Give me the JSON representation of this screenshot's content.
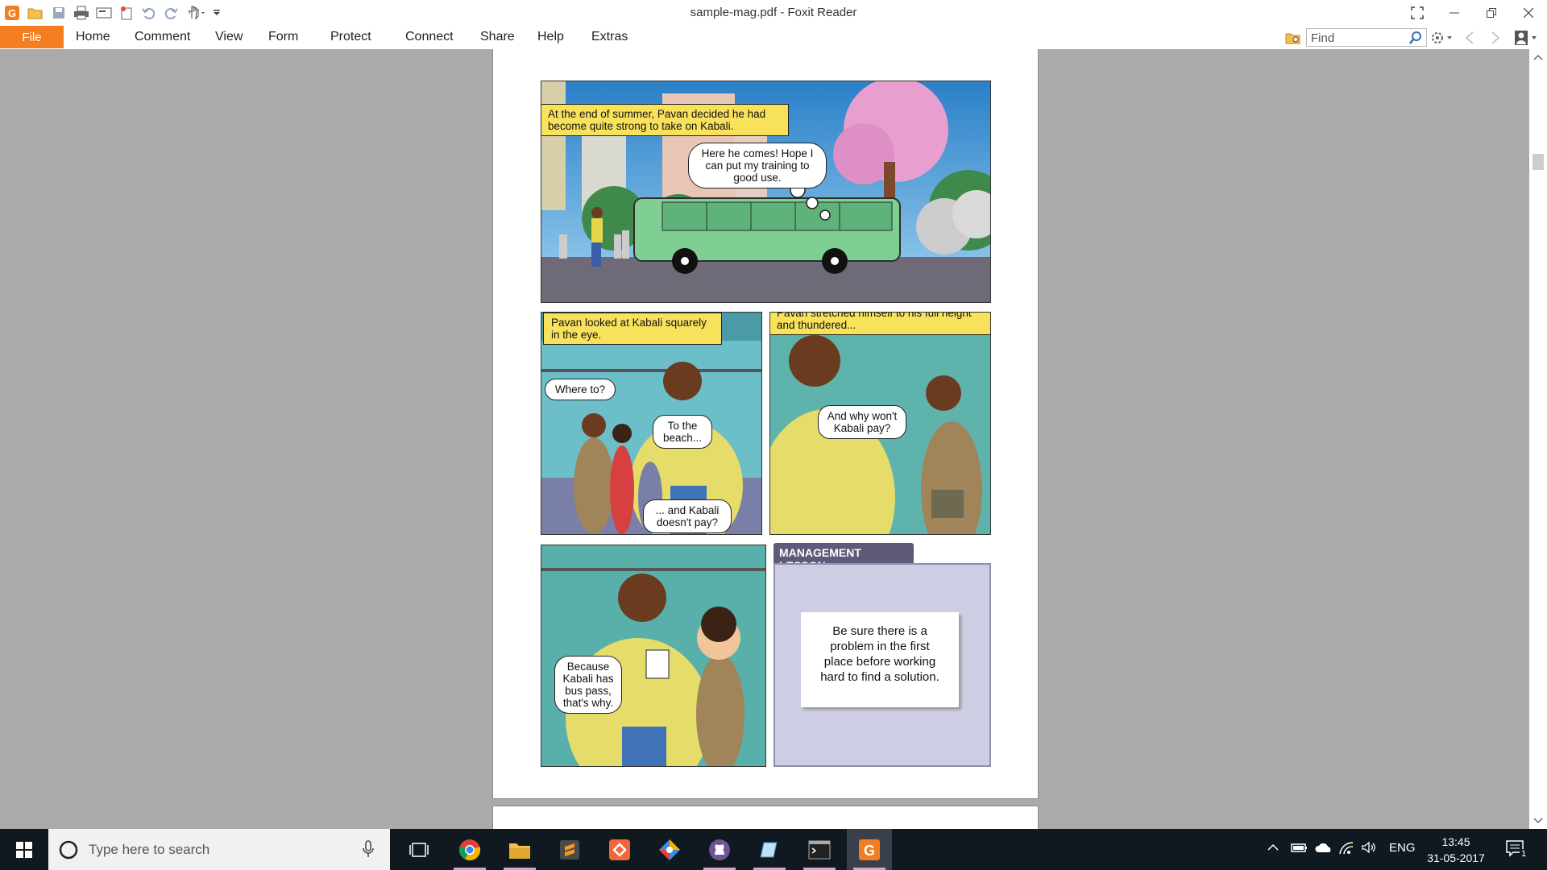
{
  "window": {
    "title": "sample-mag.pdf - Foxit Reader"
  },
  "ribbon": {
    "file_label": "File",
    "tabs": [
      "Home",
      "Comment",
      "View",
      "Form",
      "Protect",
      "Connect",
      "Share",
      "Help",
      "Extras"
    ],
    "find_placeholder": "Find"
  },
  "comic": {
    "panel1": {
      "caption": "At the end of summer, Pavan decided he had become quite strong to take on Kabali.",
      "thought": "Here he comes! Hope I can put my training to good use."
    },
    "panel2": {
      "caption": "Pavan looked at Kabali squarely in the eye.",
      "bubble1": "Where to?",
      "bubble2": "To the beach...",
      "bubble3": "... and Kabali doesn't pay?"
    },
    "panel3": {
      "caption": "Pavan stretched himself to his full height and thundered...",
      "bubble1": "And why won't Kabali pay?"
    },
    "panel4": {
      "bubble1": "Because Kabali has bus pass, that's why."
    },
    "lesson": {
      "header": "MANAGEMENT LESSON",
      "text": "Be sure there is a problem in the first place before working hard to find a solution."
    }
  },
  "taskbar": {
    "search_placeholder": "Type here to search",
    "language": "ENG",
    "time": "13:45",
    "date": "31-05-2017",
    "notification_count": "1"
  },
  "colors": {
    "foxit_orange": "#f47d20",
    "caption_yellow": "#f9e25b",
    "taskbar": "#101820"
  }
}
